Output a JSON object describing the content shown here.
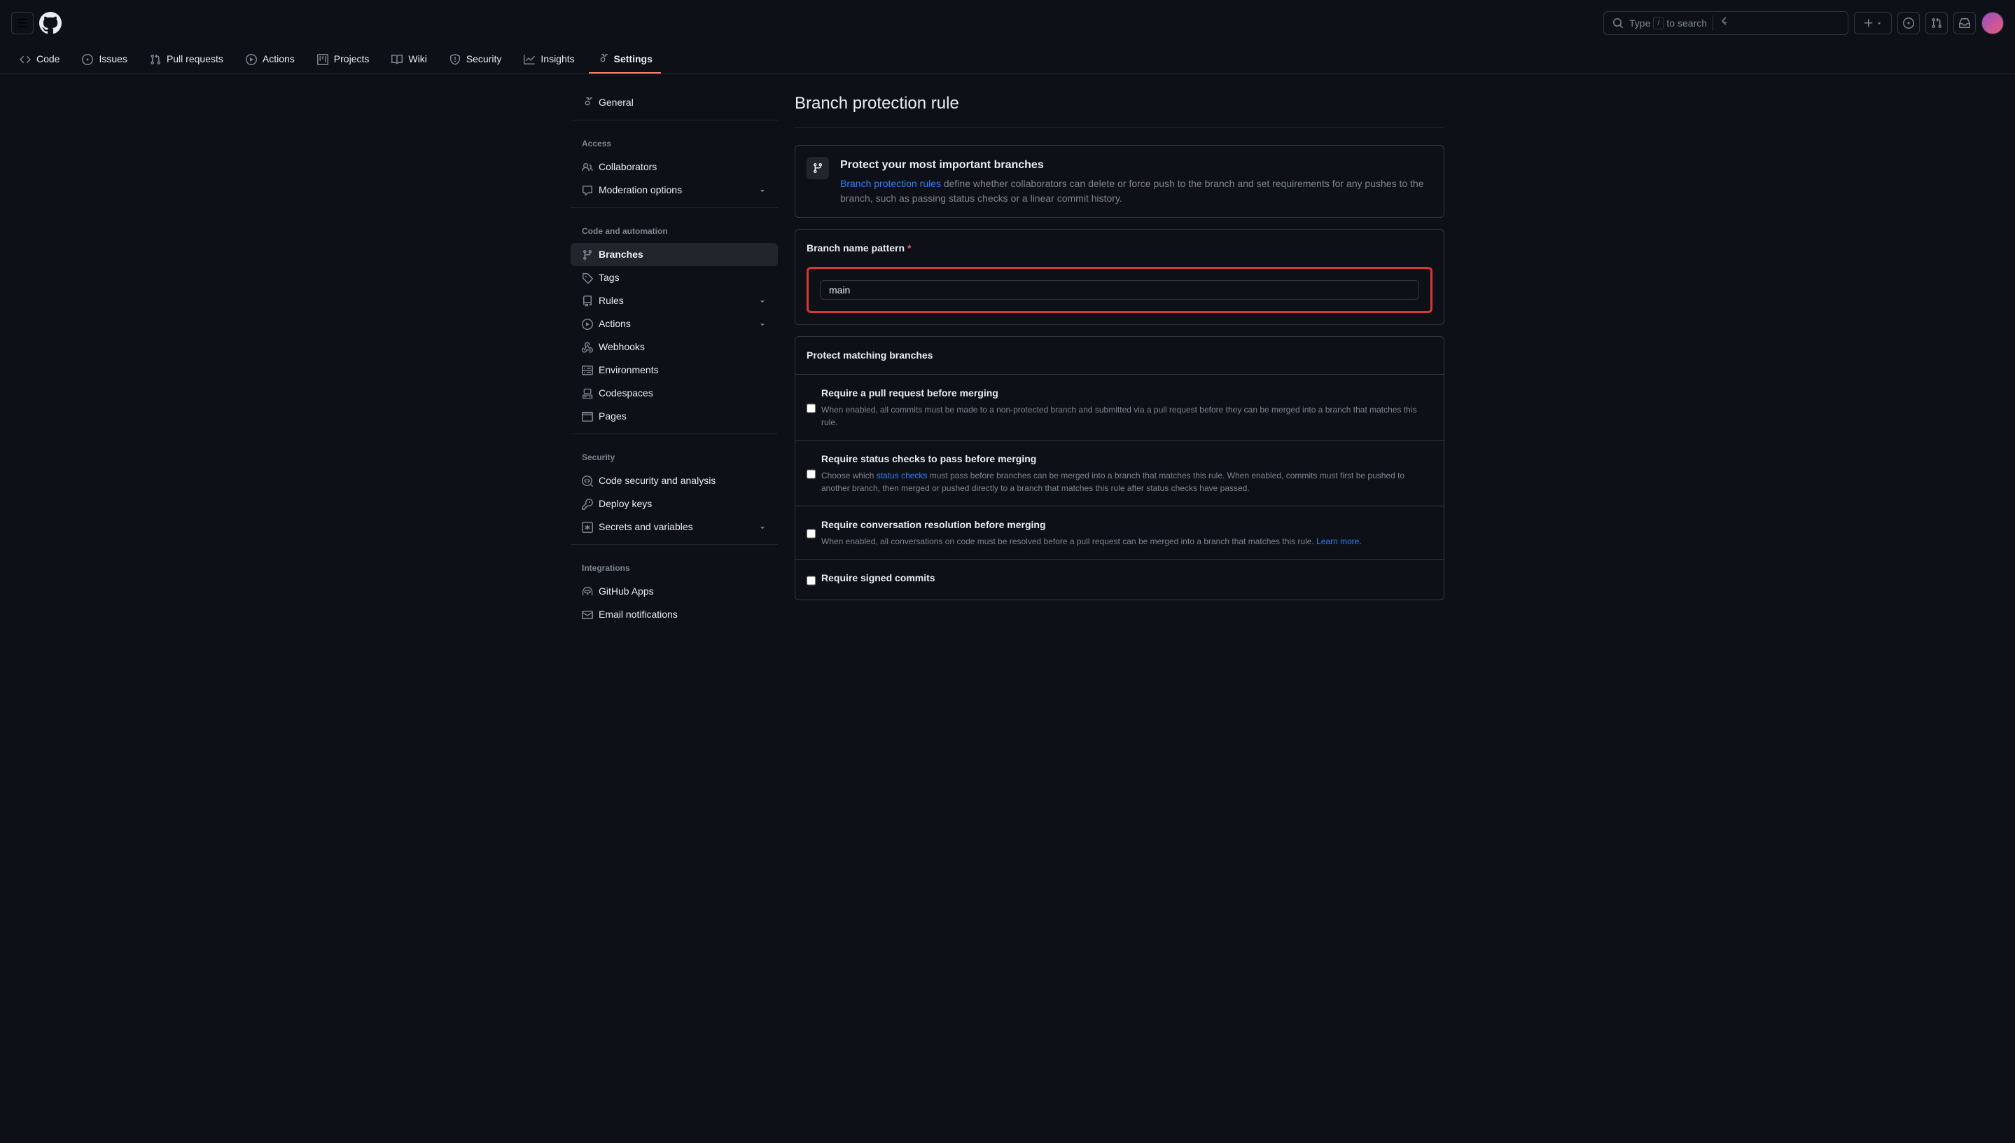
{
  "header": {
    "search_placeholder_prefix": "Type",
    "search_key": "/",
    "search_placeholder_suffix": "to search"
  },
  "repo_nav": {
    "code": "Code",
    "issues": "Issues",
    "pull_requests": "Pull requests",
    "actions": "Actions",
    "projects": "Projects",
    "wiki": "Wiki",
    "security": "Security",
    "insights": "Insights",
    "settings": "Settings"
  },
  "sidebar": {
    "general": "General",
    "access_title": "Access",
    "collaborators": "Collaborators",
    "moderation": "Moderation options",
    "automation_title": "Code and automation",
    "branches": "Branches",
    "tags": "Tags",
    "rules": "Rules",
    "actions": "Actions",
    "webhooks": "Webhooks",
    "environments": "Environments",
    "codespaces": "Codespaces",
    "pages": "Pages",
    "security_title": "Security",
    "code_security": "Code security and analysis",
    "deploy_keys": "Deploy keys",
    "secrets": "Secrets and variables",
    "integrations_title": "Integrations",
    "github_apps": "GitHub Apps",
    "email_notifications": "Email notifications"
  },
  "content": {
    "page_title": "Branch protection rule",
    "info_title": "Protect your most important branches",
    "info_link": "Branch protection rules",
    "info_text": " define whether collaborators can delete or force push to the branch and set requirements for any pushes to the branch, such as passing status checks or a linear commit history.",
    "pattern_label": "Branch name pattern",
    "pattern_value": "main",
    "rules_header": "Protect matching branches",
    "rule1_title": "Require a pull request before merging",
    "rule1_desc": "When enabled, all commits must be made to a non-protected branch and submitted via a pull request before they can be merged into a branch that matches this rule.",
    "rule2_title": "Require status checks to pass before merging",
    "rule2_desc_prefix": "Choose which ",
    "rule2_link": "status checks",
    "rule2_desc_suffix": " must pass before branches can be merged into a branch that matches this rule. When enabled, commits must first be pushed to another branch, then merged or pushed directly to a branch that matches this rule after status checks have passed.",
    "rule3_title": "Require conversation resolution before merging",
    "rule3_desc": "When enabled, all conversations on code must be resolved before a pull request can be merged into a branch that matches this rule. ",
    "rule3_link": "Learn more.",
    "rule4_title": "Require signed commits"
  }
}
